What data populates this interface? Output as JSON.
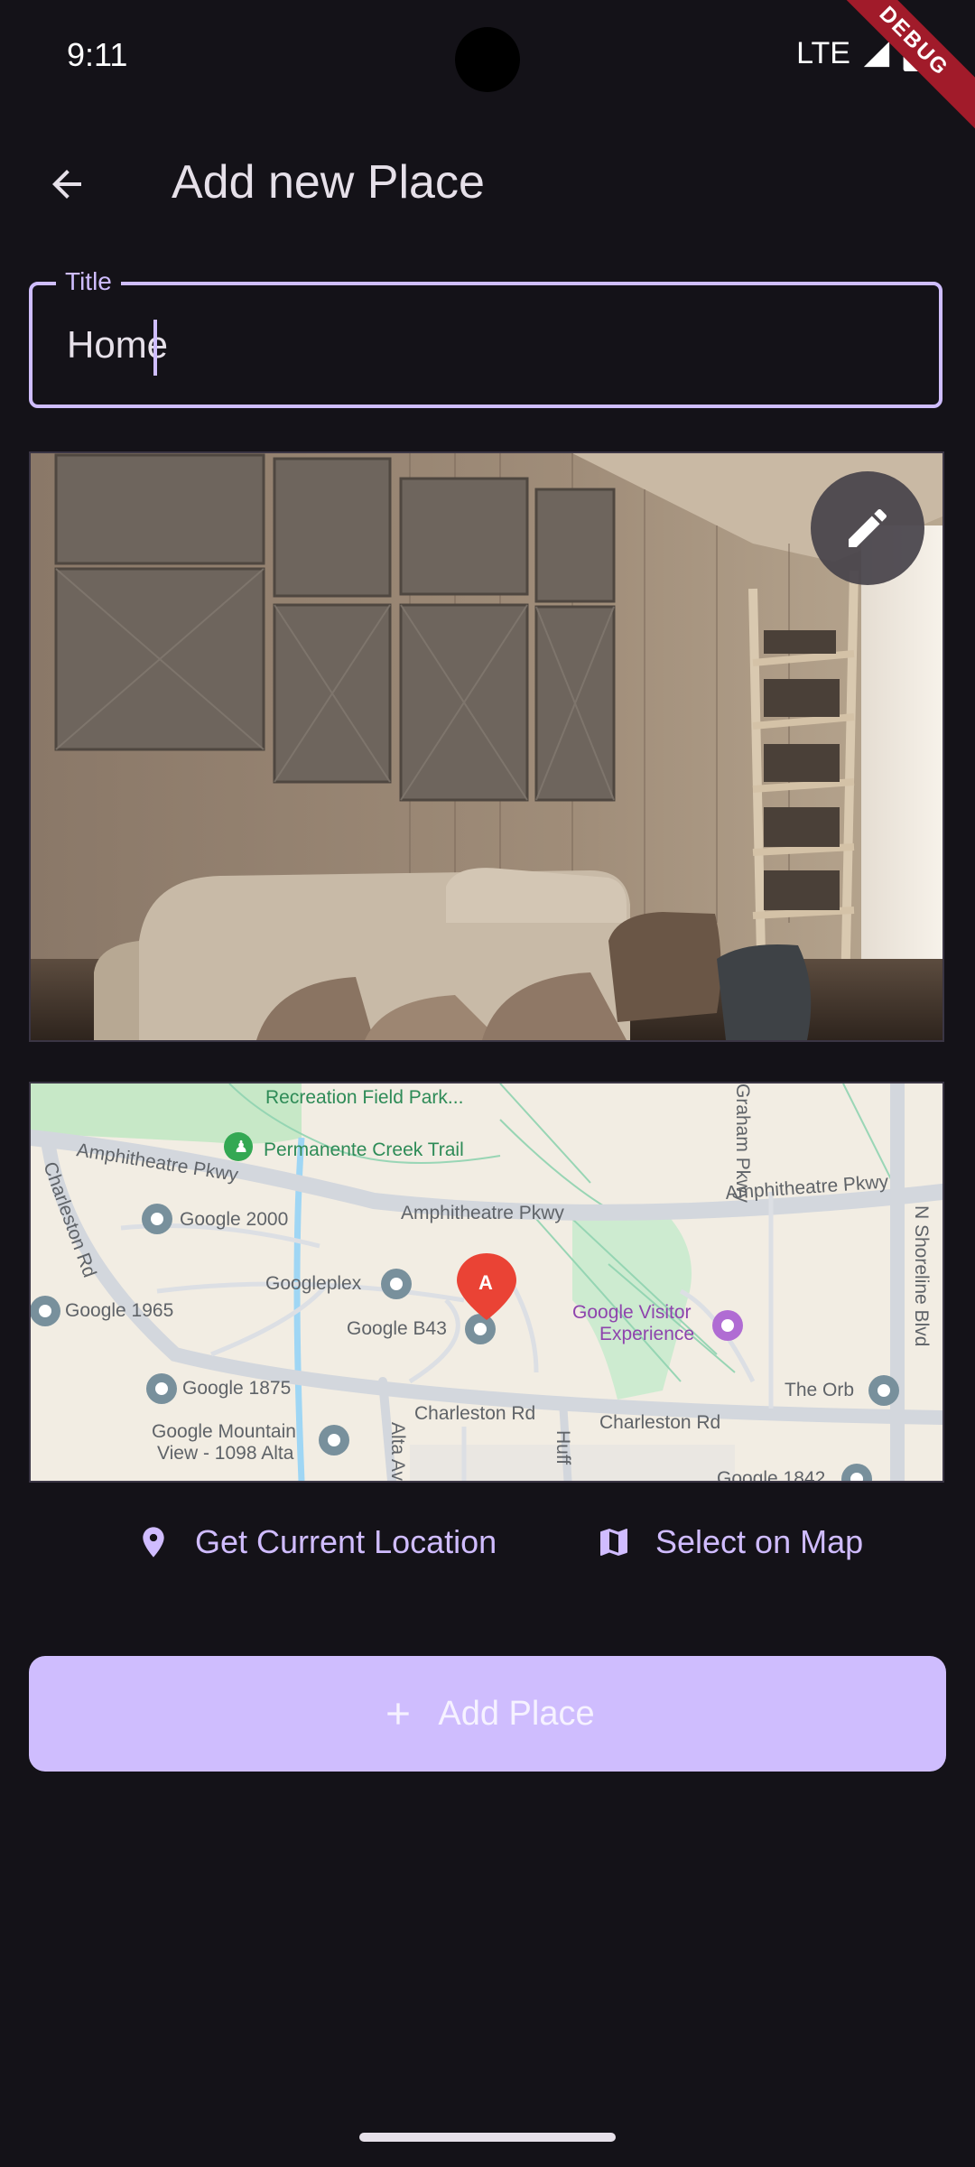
{
  "status_bar": {
    "time": "9:11",
    "network": "LTE",
    "debug_label": "DEBUG"
  },
  "app_bar": {
    "title": "Add new Place",
    "back_icon": "arrow-back-icon"
  },
  "title_field": {
    "label": "Title",
    "value": "Home"
  },
  "image_preview": {
    "edit_icon": "pencil-icon"
  },
  "map": {
    "labels": {
      "recreation": "Recreation Field Park...",
      "permanente": "Permanente Creek Trail",
      "amphitheatre_left": "Amphitheatre Pkwy",
      "amphitheatre_mid": "Amphitheatre Pkwy",
      "amphitheatre_right": "Amphitheatre Pkwy",
      "charleston_rd_left": "Charleston Rd",
      "google_2000": "Google 2000",
      "googleplex": "Googleplex",
      "google_1965": "Google 1965",
      "google_b43": "Google B43",
      "visitor_line1": "Google Visitor",
      "visitor_line2": "Experience",
      "google_1875": "Google 1875",
      "charleston_mid": "Charleston Rd",
      "charleston_right": "Charleston Rd",
      "the_orb": "The Orb",
      "mountain_line1": "Google Mountain",
      "mountain_line2": "View - 1098 Alta",
      "alta_av": "Alta Av",
      "huff": "Huff",
      "n_shoreline": "N Shoreline Blvd",
      "graham": "Graham Pkwy",
      "google_1842": "Google 1842",
      "marker_letter": "A"
    }
  },
  "actions": {
    "current_location": "Get Current Location",
    "select_on_map": "Select on Map",
    "add_place": "Add Place"
  },
  "colors": {
    "background": "#141218",
    "primary": "#cfbdfe",
    "on_surface": "#e6e0e9"
  }
}
